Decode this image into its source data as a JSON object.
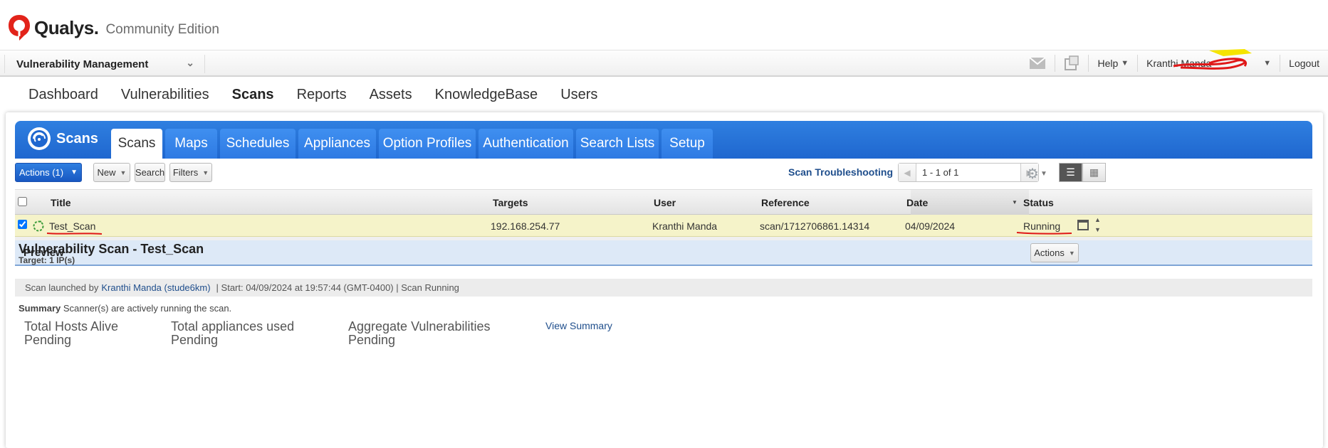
{
  "brand": {
    "name": "Qualys.",
    "edition": "Community Edition",
    "logo_color": "#e2231a"
  },
  "module": {
    "label": "Vulnerability Management"
  },
  "top_right": {
    "help": "Help",
    "user": "Kranthi Manda",
    "logout": "Logout",
    "icons": [
      "mail-icon",
      "add-widget-icon"
    ]
  },
  "main_nav": [
    "Dashboard",
    "Vulnerabilities",
    "Scans",
    "Reports",
    "Assets",
    "KnowledgeBase",
    "Users"
  ],
  "main_nav_active": "Scans",
  "section": {
    "title": "Scans"
  },
  "tabs": [
    "Scans",
    "Maps",
    "Schedules",
    "Appliances",
    "Option Profiles",
    "Authentication",
    "Search Lists",
    "Setup"
  ],
  "toolbar": {
    "actions": "Actions (1)",
    "new": "New",
    "search": "Search",
    "filters": "Filters",
    "troubleshoot": "Scan Troubleshooting",
    "pager": "1 - 1 of 1"
  },
  "table": {
    "columns": [
      "Title",
      "Targets",
      "User",
      "Reference",
      "Date",
      "Status"
    ],
    "rows": [
      {
        "title": "Test_Scan",
        "targets": "192.168.254.77",
        "user": "Kranthi Manda",
        "reference": "scan/1712706861.14314",
        "date": "04/09/2024",
        "status": "Running",
        "checked": true
      }
    ]
  },
  "preview": {
    "header": "Preview",
    "actions": "Actions",
    "scan_title": "Vulnerability Scan - Test_Scan",
    "target": "Target: 1 IP(s)",
    "launch_prefix": "Scan launched by",
    "launch_user": "Kranthi Manda (stude6km)",
    "launch_rest": "| Start: 04/09/2024 at 19:57:44 (GMT-0400) | Scan Running",
    "summary_label": "Summary",
    "summary_text": "Scanner(s) are actively running the scan.",
    "stats": [
      {
        "label": "Total Hosts Alive",
        "value": "Pending"
      },
      {
        "label": "Total appliances used",
        "value": "Pending"
      },
      {
        "label": "Aggregate Vulnerabilities",
        "value": "Pending"
      }
    ],
    "view_summary": "View Summary"
  }
}
